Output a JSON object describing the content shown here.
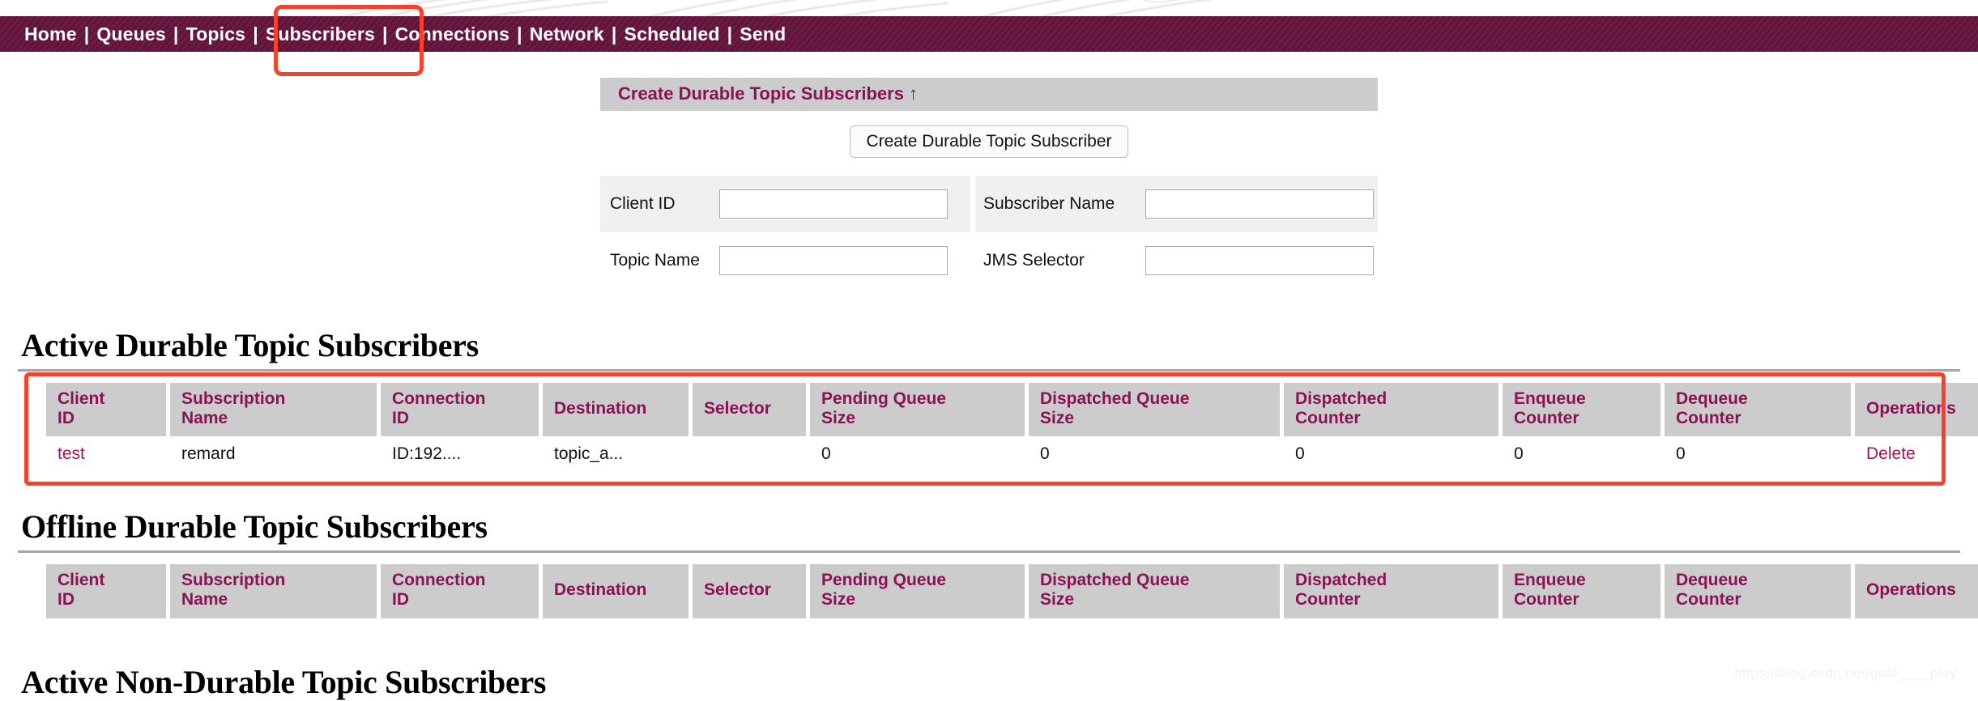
{
  "nav": {
    "separator": "|",
    "items": [
      {
        "label": "Home",
        "active": false
      },
      {
        "label": "Queues",
        "active": false
      },
      {
        "label": "Topics",
        "active": false
      },
      {
        "label": "Subscribers",
        "active": true
      },
      {
        "label": "Connections",
        "active": false
      },
      {
        "label": "Network",
        "active": false
      },
      {
        "label": "Scheduled",
        "active": false
      },
      {
        "label": "Send",
        "active": false
      }
    ]
  },
  "create_section": {
    "bar_title": "Create Durable Topic Subscribers ↑",
    "submit_label": "Create Durable Topic Subscriber",
    "fields": {
      "client_id_label": "Client ID",
      "client_id_value": "",
      "client_id_placeholder": "",
      "subscriber_name_label": "Subscriber Name",
      "subscriber_name_value": "",
      "subscriber_name_placeholder": "",
      "topic_name_label": "Topic Name",
      "topic_name_value": "",
      "topic_name_placeholder": "",
      "jms_selector_label": "JMS Selector",
      "jms_selector_value": "",
      "jms_selector_placeholder": ""
    }
  },
  "columns": [
    "Client\nID",
    "Subscription\nName",
    "Connection\nID",
    "Destination",
    "Selector",
    "Pending Queue\nSize",
    "Dispatched Queue\nSize",
    "Dispatched\nCounter",
    "Enqueue\nCounter",
    "Dequeue\nCounter",
    "Operations"
  ],
  "active_durable": {
    "heading": "Active Durable Topic Subscribers",
    "rows": [
      {
        "client_id": "test",
        "subscription_name": "remard",
        "connection_id": "ID:192....",
        "destination": "topic_a...",
        "selector": "",
        "pending_queue_size": "0",
        "dispatched_queue_size": "0",
        "dispatched_counter": "0",
        "enqueue_counter": "0",
        "dequeue_counter": "0",
        "operations": "Delete"
      }
    ]
  },
  "offline_durable": {
    "heading": "Offline Durable Topic Subscribers",
    "rows": []
  },
  "active_non_durable": {
    "heading": "Active Non-Durable Topic Subscribers"
  },
  "watermark": "https://blog.csdn.net/gold____play",
  "colors": {
    "nav_background": "#6d1b45",
    "header_text": "#8a1255",
    "link": "#a31457",
    "table_header_background": "#cccccc",
    "annotation": "#f8402a",
    "form_row_background": "#f0f0f0"
  }
}
